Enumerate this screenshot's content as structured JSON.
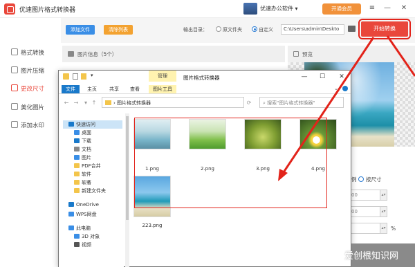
{
  "app": {
    "title": "优速图片格式转换器",
    "promo_text": "优速办公软件",
    "vip_label": "开通会员",
    "window_controls": [
      "menu-icon",
      "minimize-icon",
      "close-icon"
    ]
  },
  "toolbar": {
    "add_file": "添加文件",
    "clear_list": "清除列表",
    "output_label": "输出目录：",
    "radio_original": "原文件夹",
    "radio_custom": "自定义",
    "path_value": "C:\\Users\\admin\\Deskto",
    "start": "开始转换"
  },
  "sidebar": {
    "items": [
      {
        "label": "格式转换",
        "active": false
      },
      {
        "label": "图片压缩",
        "active": false
      },
      {
        "label": "更改尺寸",
        "active": true
      },
      {
        "label": "美化图片",
        "active": false
      },
      {
        "label": "添加水印",
        "active": false
      }
    ]
  },
  "list": {
    "header": "图片信息（5个）"
  },
  "preview": {
    "header": "预览"
  },
  "settings": {
    "ratio_partial": "例",
    "by_size": "按尺寸",
    "stepper1": "00",
    "stepper2": "00",
    "percent": "%"
  },
  "explorer": {
    "manage_tab": "管理",
    "title": "图片格式转换器",
    "ribbon_tabs": [
      "文件",
      "主页",
      "共享",
      "查看",
      "图片工具"
    ],
    "address": "图片格式转换器",
    "search_placeholder": "搜索\"图片格式转换器\"",
    "nav": [
      {
        "label": "快速访问",
        "color": "#1979ca"
      },
      {
        "label": "桌面",
        "color": "#3a8ee6"
      },
      {
        "label": "下载",
        "color": "#1979ca"
      },
      {
        "label": "文档",
        "color": "#888888"
      },
      {
        "label": "图片",
        "color": "#3a8ee6"
      },
      {
        "label": "PDF合并",
        "color": "#f3c54b"
      },
      {
        "label": "软件",
        "color": "#f3c54b"
      },
      {
        "label": "软著",
        "color": "#f3c54b"
      },
      {
        "label": "新建文件夹",
        "color": "#f3c54b"
      },
      {
        "label": "OneDrive",
        "color": "#1979ca"
      },
      {
        "label": "WPS网盘",
        "color": "#3a8ee6"
      },
      {
        "label": "此电脑",
        "color": "#3a8ee6"
      },
      {
        "label": "3D 对象",
        "color": "#3a8ee6"
      },
      {
        "label": "视频",
        "color": "#555555"
      }
    ],
    "files": [
      {
        "name": "1.png"
      },
      {
        "name": "2.png"
      },
      {
        "name": "3.png"
      },
      {
        "name": "4.png"
      },
      {
        "name": "223.png"
      }
    ]
  },
  "watermark": "爱创根知识网"
}
